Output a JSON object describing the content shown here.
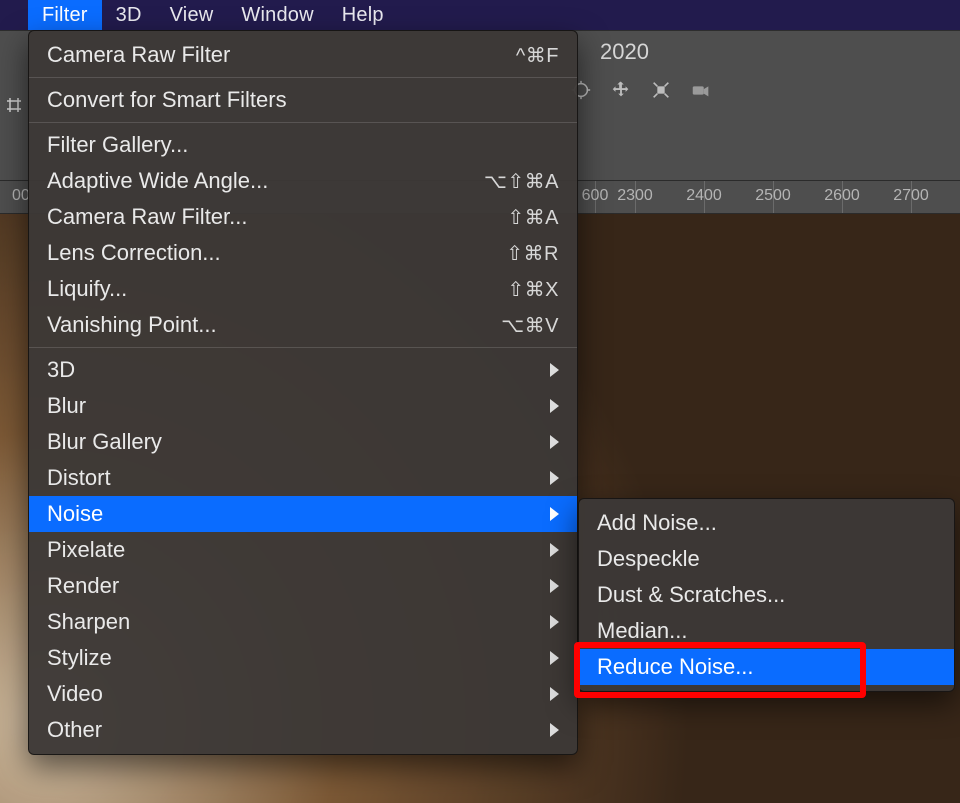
{
  "menubar": {
    "items": [
      "Filter",
      "3D",
      "View",
      "Window",
      "Help"
    ],
    "active_index": 0
  },
  "options_bar": {
    "right_text": "2020",
    "icons": [
      "target-icon",
      "move-icon",
      "scale-icon",
      "camera-icon"
    ]
  },
  "ruler": {
    "left_fragment": "00",
    "marks": [
      600,
      2300,
      2400,
      2500,
      2600,
      2700
    ]
  },
  "filter_menu": {
    "groups": [
      [
        {
          "label": "Camera Raw Filter",
          "shortcut": "^⌘F"
        }
      ],
      [
        {
          "label": "Convert for Smart Filters"
        }
      ],
      [
        {
          "label": "Filter Gallery..."
        },
        {
          "label": "Adaptive Wide Angle...",
          "shortcut": "⌥⇧⌘A"
        },
        {
          "label": "Camera Raw Filter...",
          "shortcut": "⇧⌘A"
        },
        {
          "label": "Lens Correction...",
          "shortcut": "⇧⌘R"
        },
        {
          "label": "Liquify...",
          "shortcut": "⇧⌘X"
        },
        {
          "label": "Vanishing Point...",
          "shortcut": "⌥⌘V"
        }
      ],
      [
        {
          "label": "3D",
          "submenu": true
        },
        {
          "label": "Blur",
          "submenu": true
        },
        {
          "label": "Blur Gallery",
          "submenu": true
        },
        {
          "label": "Distort",
          "submenu": true
        },
        {
          "label": "Noise",
          "submenu": true,
          "selected": true
        },
        {
          "label": "Pixelate",
          "submenu": true
        },
        {
          "label": "Render",
          "submenu": true
        },
        {
          "label": "Sharpen",
          "submenu": true
        },
        {
          "label": "Stylize",
          "submenu": true
        },
        {
          "label": "Video",
          "submenu": true
        },
        {
          "label": "Other",
          "submenu": true
        }
      ]
    ]
  },
  "noise_submenu": {
    "items": [
      {
        "label": "Add Noise..."
      },
      {
        "label": "Despeckle"
      },
      {
        "label": "Dust & Scratches..."
      },
      {
        "label": "Median..."
      },
      {
        "label": "Reduce Noise...",
        "selected": true,
        "highlighted": true
      }
    ]
  }
}
